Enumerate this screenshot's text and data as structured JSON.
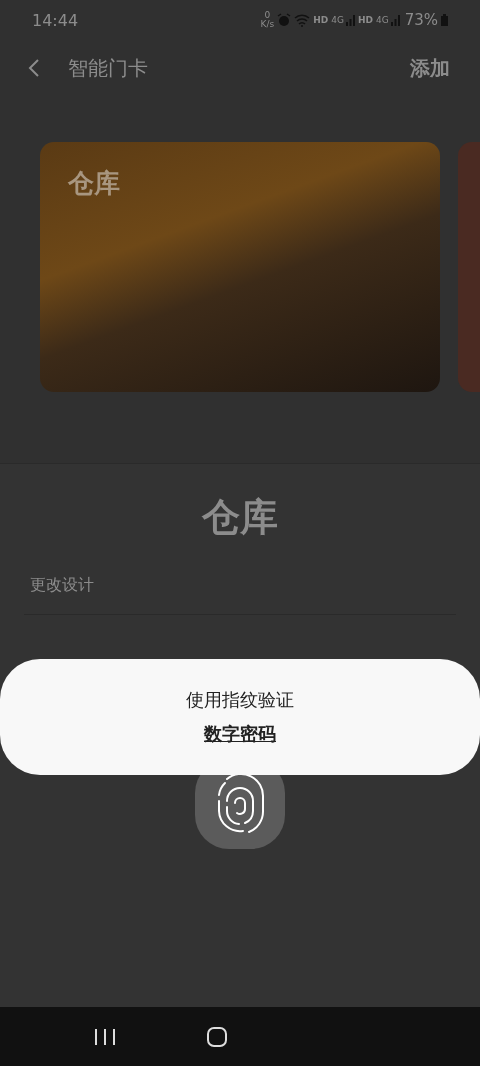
{
  "status_bar": {
    "time": "14:44",
    "net_speed": [
      "0",
      "K/s"
    ],
    "network_labels": [
      {
        "hd": "HD",
        "gen": "4G"
      },
      {
        "hd": "HD",
        "gen": "4G"
      }
    ],
    "battery": "73%"
  },
  "header": {
    "title": "智能门卡",
    "action": "添加"
  },
  "cards": [
    {
      "label": "仓库",
      "selected": true
    },
    {
      "selected": false
    }
  ],
  "sheet": {
    "title": "仓库",
    "items": [
      "更改设计"
    ]
  },
  "auth_dialog": {
    "message": "使用指纹验证",
    "link": "数字密码"
  },
  "nav_bar": {
    "buttons": [
      {
        "kind": "recents"
      },
      {
        "kind": "home"
      }
    ]
  }
}
